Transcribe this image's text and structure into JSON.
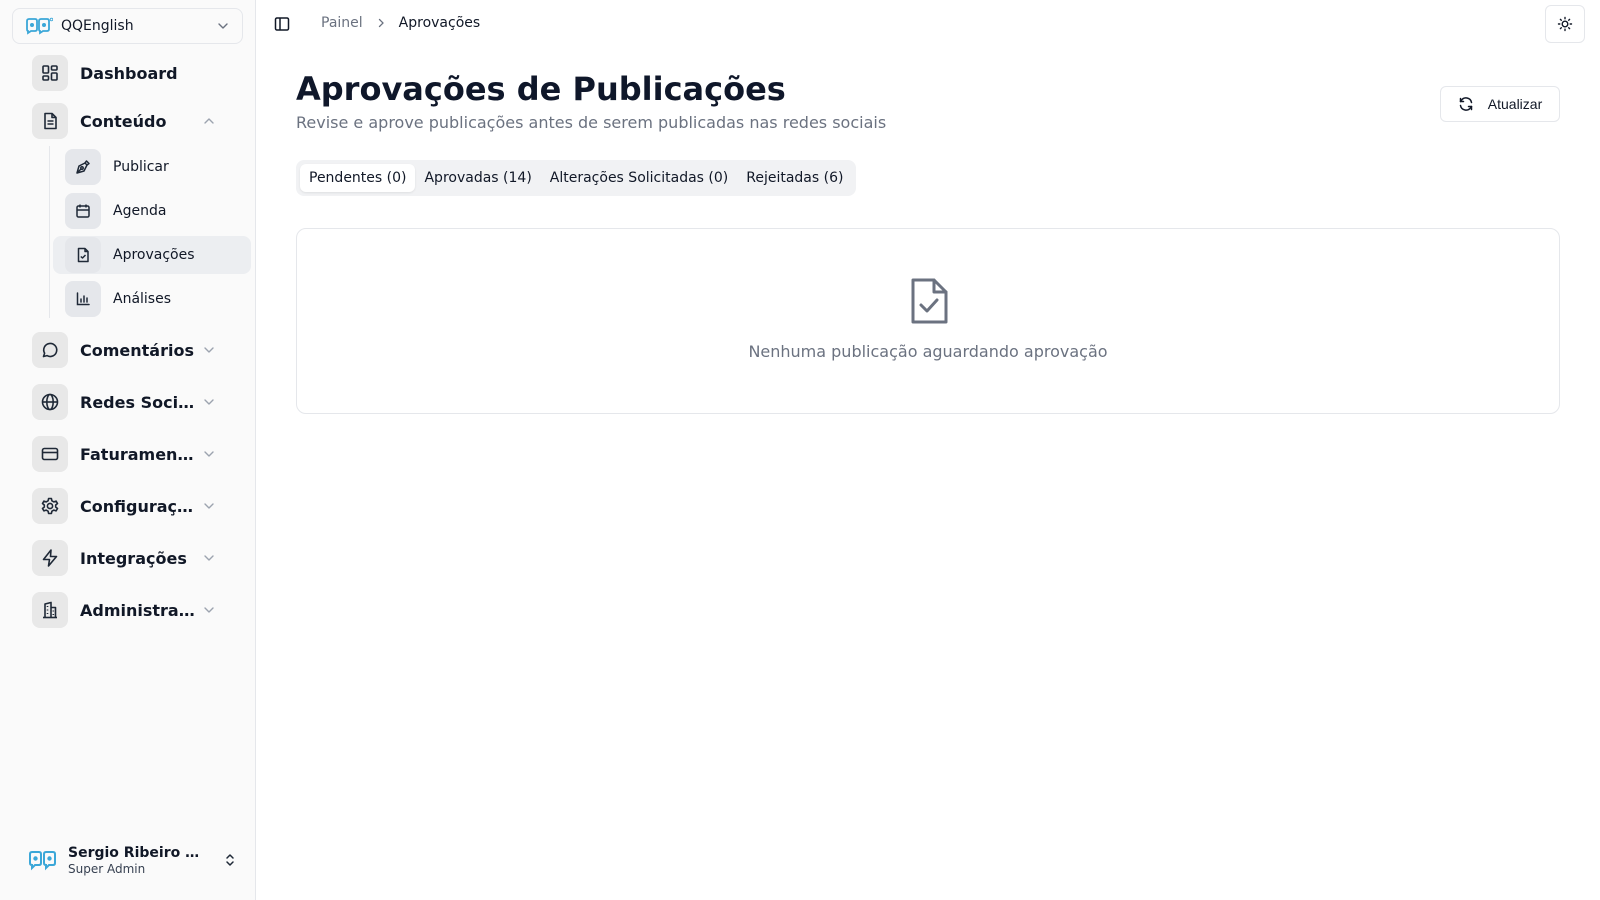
{
  "sidebar": {
    "org": {
      "name": "QQEnglish",
      "logo_icon": "qq-logo-icon"
    },
    "items": [
      {
        "label": "Dashboard",
        "icon": "layout-grid-icon"
      },
      {
        "label": "Conteúdo",
        "icon": "file-text-icon",
        "expanded": true
      },
      {
        "label": "Comentários",
        "icon": "message-circle-icon"
      },
      {
        "label": "Redes Sociais",
        "icon": "globe-icon"
      },
      {
        "label": "Faturamento",
        "icon": "credit-card-icon"
      },
      {
        "label": "Configurações",
        "icon": "settings-icon"
      },
      {
        "label": "Integrações",
        "icon": "zap-icon"
      },
      {
        "label": "Administração",
        "icon": "building-icon"
      }
    ],
    "sub_items": [
      {
        "label": "Publicar",
        "icon": "pen-tool-icon"
      },
      {
        "label": "Agenda",
        "icon": "calendar-icon"
      },
      {
        "label": "Aprovações",
        "icon": "file-check-icon",
        "active": true
      },
      {
        "label": "Análises",
        "icon": "bar-chart-icon"
      }
    ],
    "user": {
      "name": "Sergio Ribeiro Kodama",
      "role": "Super Admin"
    }
  },
  "header": {
    "breadcrumb": [
      "Painel",
      "Aprovações"
    ]
  },
  "main": {
    "title": "Aprovações de Publicações",
    "subtitle": "Revise e aprove publicações antes de serem publicadas nas redes sociais",
    "refresh_label": "Atualizar",
    "tabs": [
      {
        "label": "Pendentes (0)",
        "active": true
      },
      {
        "label": "Aprovadas (14)"
      },
      {
        "label": "Alterações Solicitadas (0)"
      },
      {
        "label": "Rejeitadas (6)"
      }
    ],
    "empty_message": "Nenhuma publicação aguardando aprovação"
  },
  "colors": {
    "accent": "#0f172a",
    "muted": "#6b7280",
    "brand": "#3ba7d8"
  }
}
